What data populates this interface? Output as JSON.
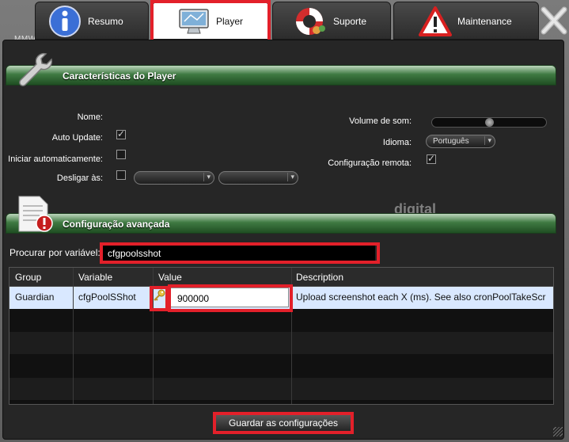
{
  "background": {
    "file_label": "MMWVDSI.PDF",
    "brand_text": "digital"
  },
  "tabs": [
    {
      "label": "Resumo",
      "icon": "info-icon"
    },
    {
      "label": "Player",
      "icon": "monitor-icon"
    },
    {
      "label": "Suporte",
      "icon": "lifebuoy-icon"
    },
    {
      "label": "Maintenance",
      "icon": "warning-icon"
    }
  ],
  "player_panel": {
    "title": "Características do Player",
    "labels": {
      "name": "Nome:",
      "auto_update": "Auto Update:",
      "autostart": "Iniciar automaticamente:",
      "shutdown": "Desligar às:",
      "volume": "Volume de som:",
      "language": "Idioma:",
      "remote_config": "Configuração remota:"
    },
    "auto_update_checked": true,
    "autostart_checked": false,
    "shutdown_checked": false,
    "language_value": "Português",
    "volume_level": 0.5,
    "remote_config_checked": true
  },
  "advanced_panel": {
    "title": "Configuração avançada",
    "search_label": "Procurar por variável:",
    "search_value": "cfgpoolsshot"
  },
  "grid": {
    "columns": [
      "Group",
      "Variable",
      "Value",
      "Description"
    ],
    "rows": [
      {
        "group": "Guardian",
        "variable": "cfgPoolSShot",
        "value": "900000",
        "description": "Upload screenshot each X (ms). See also cronPoolTakeScr"
      }
    ]
  },
  "save_button": "Guardar as configurações",
  "colors": {
    "highlight": "#e3202a",
    "header_green": "#3f7a42",
    "selected_row": "#d9e8ff"
  }
}
